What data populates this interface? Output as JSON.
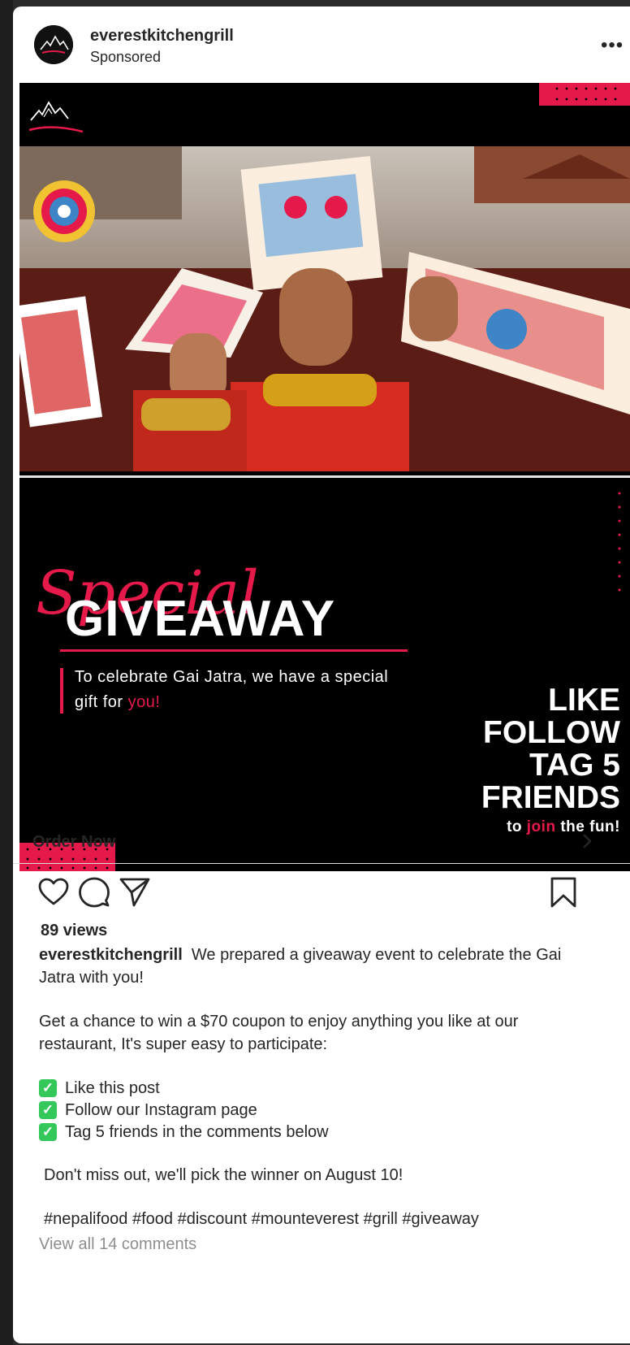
{
  "post": {
    "username": "everestkitchengrill",
    "sponsored": "Sponsored",
    "more_label": "•••"
  },
  "creative": {
    "script_word": "Special",
    "headline": "GIVEAWAY",
    "tagline_pre": "To celebrate Gai Jatra, we have a special gift for ",
    "tagline_accent": "you!",
    "cta_lines": [
      "LIKE",
      "FOLLOW",
      "TAG 5",
      "FRIENDS"
    ],
    "join_pre": "to ",
    "join_accent": "join",
    "join_post": " the fun!",
    "accent_color": "#e5194a"
  },
  "order": {
    "label": "Order Now"
  },
  "stats": {
    "views": "89 views"
  },
  "caption": {
    "username": "everestkitchengrill",
    "intro": "We prepared a giveaway event to celebrate the Gai Jatra with you!",
    "paragraph2": "Get a chance to win a $70 coupon to enjoy anything you like at our restaurant, It's super easy to participate:",
    "checklist": [
      "Like this post",
      "Follow our Instagram page",
      "Tag 5 friends in the comments below"
    ],
    "reminder": "Don't miss out, we'll pick the winner on August 10!",
    "hashtags": "#nepalifood #food #discount #mounteverest #grill #giveaway"
  },
  "comments": {
    "view_all": "View all 14 comments"
  },
  "icons": {
    "like": "heart-icon",
    "comment": "comment-icon",
    "share": "send-icon",
    "save": "bookmark-icon",
    "check": "check-icon"
  }
}
